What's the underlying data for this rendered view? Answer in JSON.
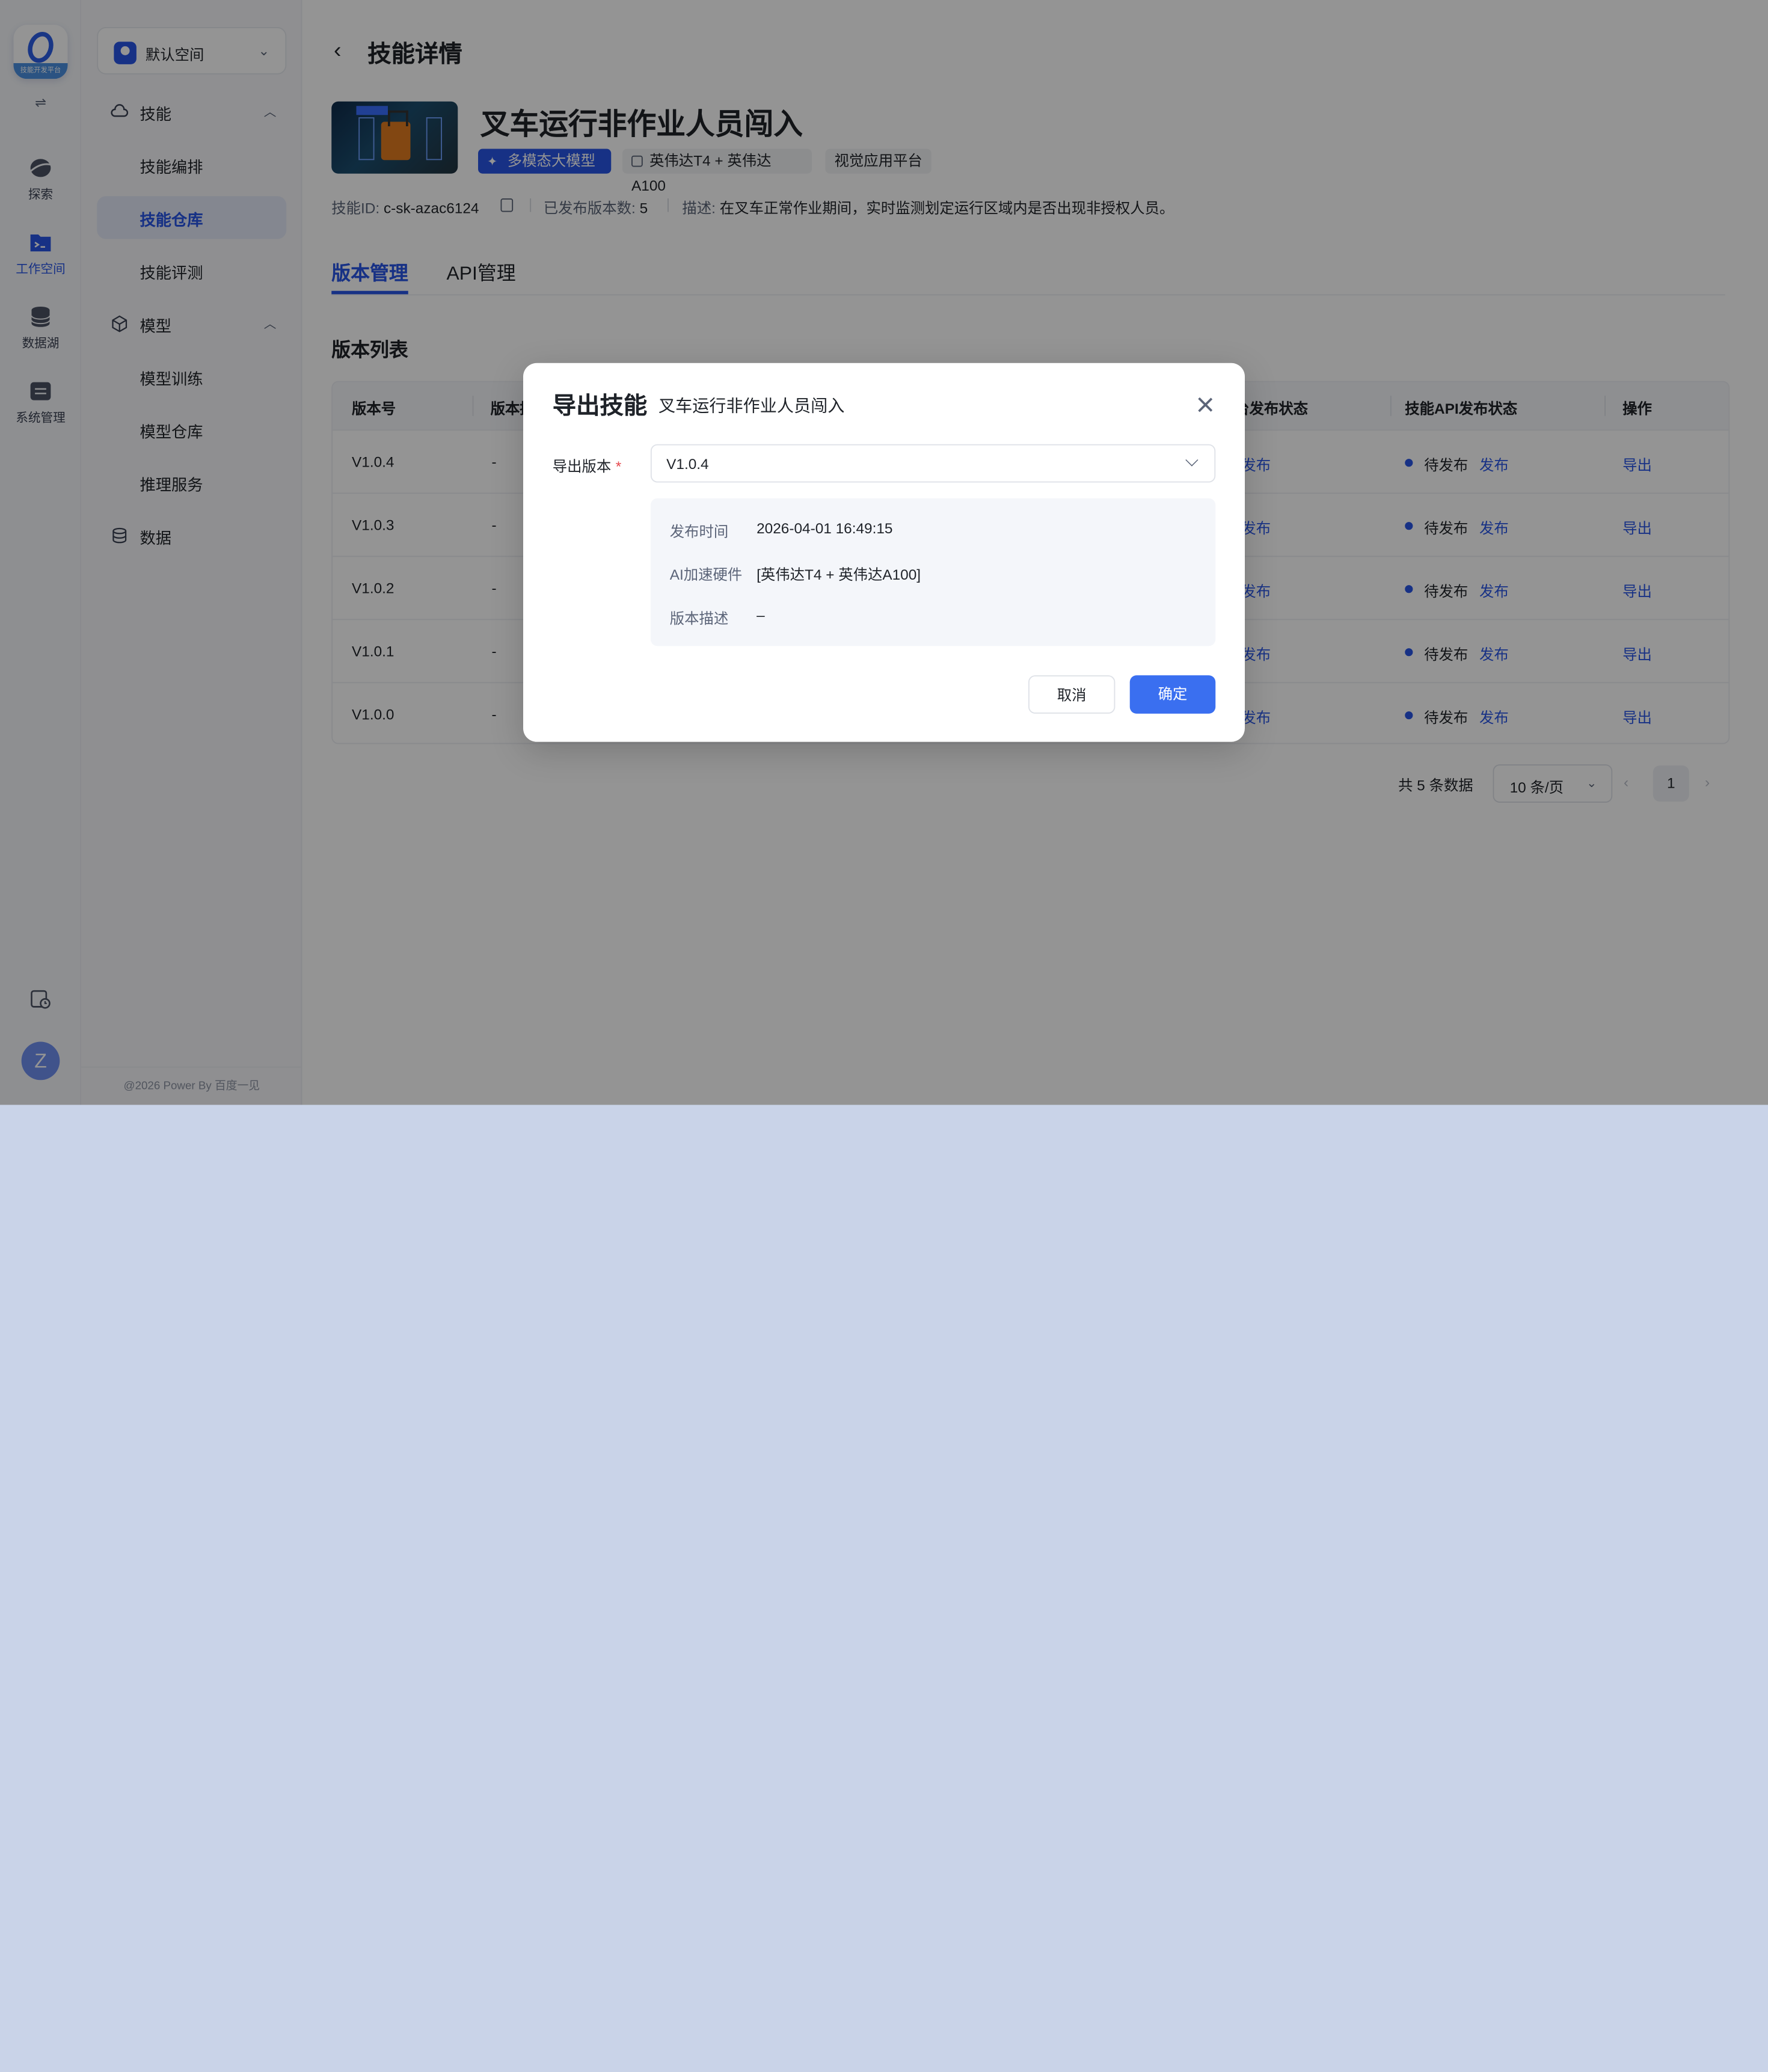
{
  "app": {
    "logo_text": "技能开发平台"
  },
  "rail": {
    "items": [
      {
        "label": "探索",
        "icon": "planet-icon"
      },
      {
        "label": "工作空间",
        "icon": "terminal-folder-icon",
        "active": true
      },
      {
        "label": "数据湖",
        "icon": "database-icon"
      },
      {
        "label": "系统管理",
        "icon": "settings-panel-icon"
      }
    ],
    "avatar": "Z"
  },
  "sidebar": {
    "space": "默认空间",
    "groups": [
      {
        "label": "技能",
        "items": [
          "技能编排",
          "技能仓库",
          "技能评测"
        ]
      },
      {
        "label": "模型",
        "items": [
          "模型训练",
          "模型仓库",
          "推理服务"
        ]
      },
      {
        "label": "数据",
        "items": []
      }
    ],
    "active_item": "技能仓库",
    "copyright": "@2026 Power By 百度一见"
  },
  "header": {
    "title": "技能详情"
  },
  "skill": {
    "name": "叉车运行非作业人员闯入",
    "tags": {
      "model": "多模态大模型",
      "hardware": "英伟达T4 + 英伟达A100",
      "platform": "视觉应用平台"
    },
    "id_label": "技能ID:",
    "id_value": "c-sk-azac6124",
    "count_label": "已发布版本数:",
    "count_value": "5",
    "desc_label": "描述:",
    "desc_value": "在叉车正常作业期间，实时监测划定运行区域内是否出现非授权人员。",
    "thumb_tag": "人员危险"
  },
  "tabs": [
    {
      "label": "版本管理",
      "active": true
    },
    {
      "label": "API管理",
      "active": false
    }
  ],
  "version_list": {
    "title": "版本列表",
    "columns": [
      "版本号",
      "版本描",
      "台发布状态",
      "技能API发布状态",
      "操作"
    ],
    "rows": [
      {
        "version": "V1.0.4",
        "desc": "-",
        "pub": "发布",
        "api_status": "待发布",
        "api_action": "发布",
        "op": "导出"
      },
      {
        "version": "V1.0.3",
        "desc": "-",
        "pub": "发布",
        "api_status": "待发布",
        "api_action": "发布",
        "op": "导出"
      },
      {
        "version": "V1.0.2",
        "desc": "-",
        "pub": "发布",
        "api_status": "待发布",
        "api_action": "发布",
        "op": "导出"
      },
      {
        "version": "V1.0.1",
        "desc": "-",
        "pub": "发布",
        "api_status": "待发布",
        "api_action": "发布",
        "op": "导出"
      },
      {
        "version": "V1.0.0",
        "desc": "-",
        "pub": "发布",
        "api_status": "待发布",
        "api_action": "发布",
        "op": "导出"
      }
    ]
  },
  "pager": {
    "total": "共 5 条数据",
    "page_size": "10 条/页",
    "current": "1"
  },
  "modal": {
    "title": "导出技能",
    "subtitle": "叉车运行非作业人员闯入",
    "field_label": "导出版本",
    "required_mark": "*",
    "selected_version": "V1.0.4",
    "details": [
      {
        "key": "发布时间",
        "value": "2026-04-01 16:49:15"
      },
      {
        "key": "AI加速硬件",
        "value": "[英伟达T4 + 英伟达A100]"
      },
      {
        "key": "版本描述",
        "value": "–"
      }
    ],
    "cancel_label": "取消",
    "ok_label": "确定"
  },
  "colors": {
    "accent": "#2955e6",
    "primary_button": "#3a6ff0"
  }
}
